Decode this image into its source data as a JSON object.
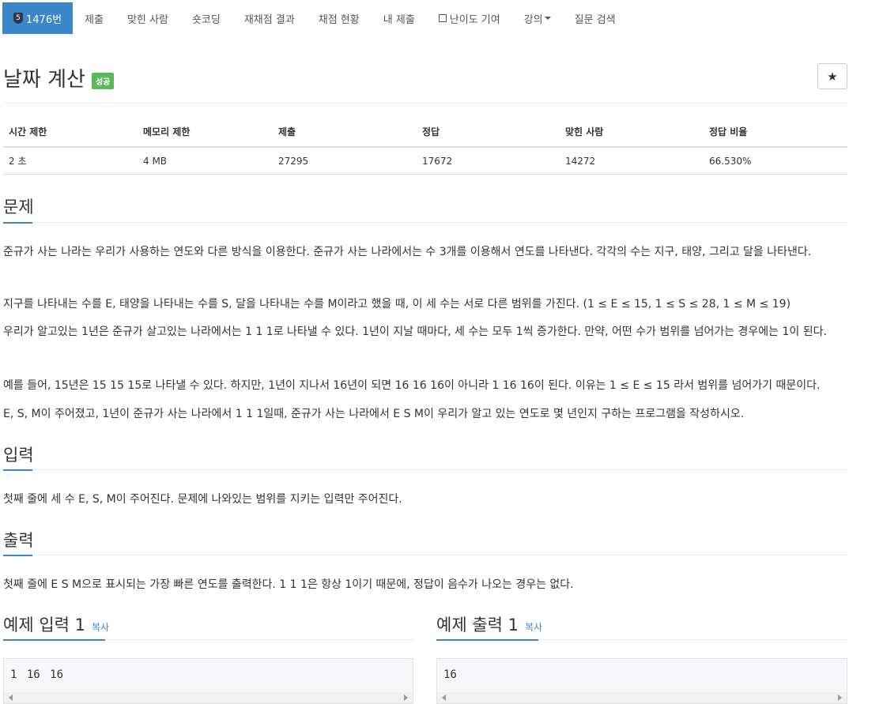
{
  "nav": {
    "problem_id": "1476번",
    "tier_icon": "5",
    "items": [
      "제출",
      "맞힌 사람",
      "숏코딩",
      "재채점 결과",
      "채점 현황",
      "내 제출",
      "난이도 기여",
      "강의",
      "질문 검색"
    ]
  },
  "title": "날짜 계산",
  "badge": "성공",
  "star_icon": "★",
  "info": {
    "headers": [
      "시간 제한",
      "메모리 제한",
      "제출",
      "정답",
      "맞힌 사람",
      "정답 비율"
    ],
    "values": [
      "2 초",
      "4 MB",
      "27295",
      "17672",
      "14272",
      "66.530%"
    ]
  },
  "sections": {
    "problem_title": "문제",
    "problem_p1": "준규가 사는 나라는 우리가 사용하는 연도와 다른 방식을 이용한다. 준규가 사는 나라에서는 수 3개를 이용해서 연도를 나타낸다. 각각의 수는 지구, 태양, 그리고 달을 나타낸다.",
    "problem_p2": "지구를 나타내는 수를 E, 태양을 나타내는 수를 S, 달을 나타내는 수를 M이라고 했을 때, 이 세 수는 서로 다른 범위를 가진다. (1 ≤ E ≤ 15, 1 ≤ S ≤ 28, 1 ≤ M ≤ 19)",
    "problem_p3": "우리가 알고있는 1년은 준규가 살고있는 나라에서는 1 1 1로 나타낼 수 있다. 1년이 지날 때마다, 세 수는 모두 1씩 증가한다. 만약, 어떤 수가 범위를 넘어가는 경우에는 1이 된다.",
    "problem_p4": "예를 들어, 15년은 15 15 15로 나타낼 수 있다. 하지만, 1년이 지나서 16년이 되면 16 16 16이 아니라 1 16 16이 된다. 이유는 1 ≤ E ≤ 15 라서 범위를 넘어가기 때문이다.",
    "problem_p5": "E, S, M이 주어졌고, 1년이 준규가 사는 나라에서 1 1 1일때, 준규가 사는 나라에서 E S M이 우리가 알고 있는 연도로 몇 년인지 구하는 프로그램을 작성하시오.",
    "input_title": "입력",
    "input_p": "첫째 줄에 세 수 E, S, M이 주어진다. 문제에 나와있는 범위를 지키는 입력만 주어진다.",
    "output_title": "출력",
    "output_p": "첫째 줄에 E S M으로 표시되는 가장 빠른 연도를 출력한다. 1 1 1은 항상 1이기 때문에, 정답이 음수가 나오는 경우는 없다."
  },
  "samples": {
    "input_title": "예제 입력 1",
    "output_title": "예제 출력 1",
    "copy_label": "복사",
    "input_value": "1 16 16",
    "output_value": "16"
  }
}
